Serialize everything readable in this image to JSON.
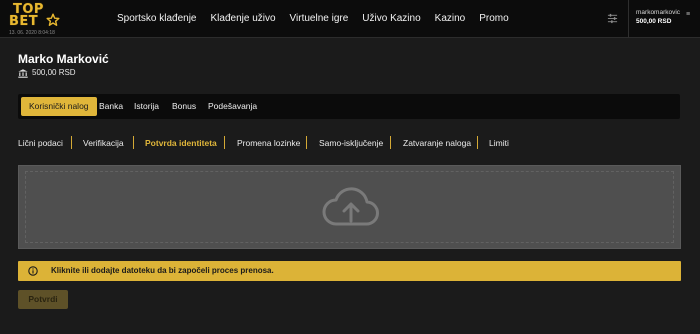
{
  "header": {
    "logo": {
      "line1": "TOP",
      "line2": "BET"
    },
    "datetime": "13. 06. 2020 8:04:18",
    "nav": [
      "Sportsko klađenje",
      "Klađenje uživo",
      "Virtuelne igre",
      "Uživo Kazino",
      "Kazino",
      "Promo"
    ],
    "filter_icon": "sliders-icon",
    "user": {
      "username": "markomarkovic",
      "balance": "500,00 RSD",
      "chevron_icon": "chevron-down-icon"
    }
  },
  "profile": {
    "name": "Marko Marković",
    "balance": "500,00 RSD",
    "balance_icon": "bank-icon"
  },
  "subnav": {
    "items": [
      "Korisnički nalog",
      "Banka",
      "Istorija",
      "Bonus",
      "Podešavanja"
    ],
    "active": "Korisnički nalog"
  },
  "tabs": {
    "items": [
      "Lični podaci",
      "Verifikacija",
      "Potvrda identiteta",
      "Promena lozinke",
      "Samo-isključenje",
      "Zatvaranje naloga",
      "Limiti"
    ],
    "active": "Potvrda identiteta"
  },
  "upload": {
    "icon": "cloud-upload-icon"
  },
  "alert": {
    "icon": "info-icon",
    "text": "Kliknite ili dodajte datoteku da bi započeli proces prenosa."
  },
  "actions": {
    "submit_label": "Potvrdi"
  },
  "colors": {
    "accent": "#e0b63a",
    "background": "#1b1b1b",
    "topbar": "#0c0c0c",
    "dropzone": "#4f4f4f"
  }
}
